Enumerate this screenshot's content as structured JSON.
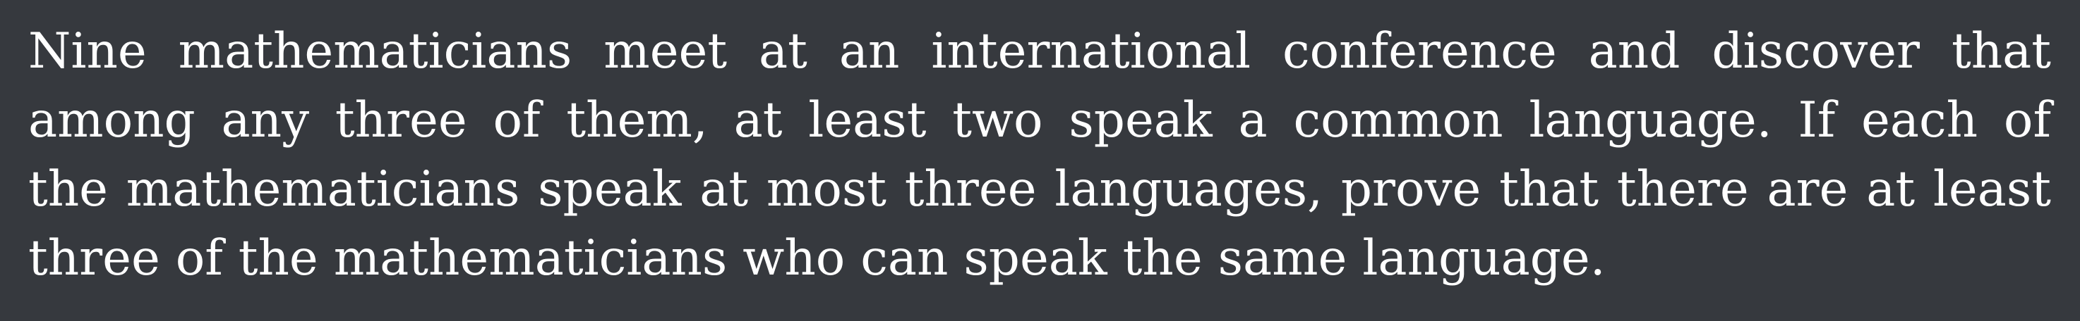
{
  "problem": {
    "lines": [
      "Nine mathematicians meet at an international conference and discover that",
      "among any three of them, at least two speak a common language. If each of",
      "the mathematicians speak at most three languages, prove that there are at least",
      "three of the mathematicians who can speak the same language."
    ]
  }
}
